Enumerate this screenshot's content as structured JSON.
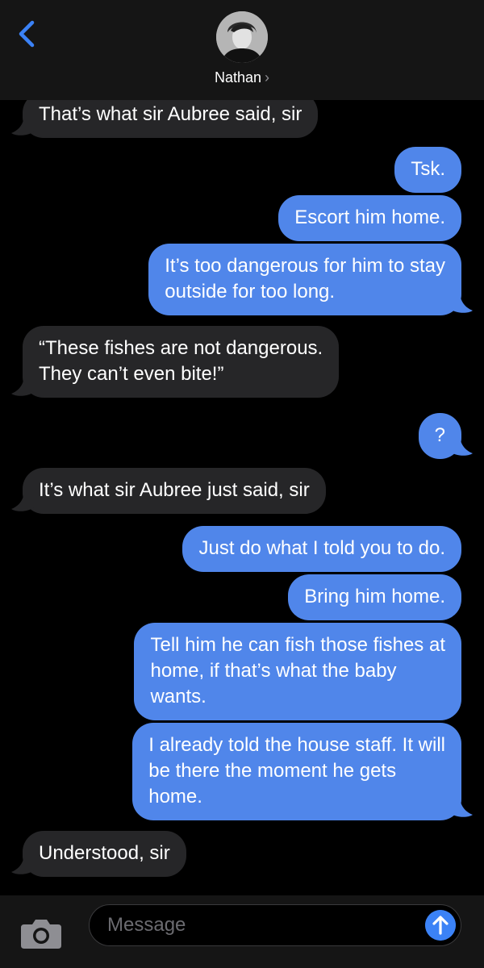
{
  "header": {
    "contact_name": "Nathan",
    "chevron": "›",
    "back_icon": "chevron-left-icon",
    "avatar_icon": "contact-avatar"
  },
  "messages": [
    {
      "side": "in",
      "text": "That’s what sir Aubree said, sir",
      "tail": true
    },
    {
      "side": "out",
      "text": "Tsk.",
      "tail": false
    },
    {
      "side": "out",
      "text": "Escort him home.",
      "tail": false
    },
    {
      "side": "out",
      "text": "It’s too dangerous for him to stay\noutside for too long.",
      "tail": true
    },
    {
      "side": "in",
      "text": "“These fishes are not dangerous.\nThey can’t even bite!”",
      "tail": true
    },
    {
      "side": "out",
      "text": "?",
      "tail": true
    },
    {
      "side": "in",
      "text": "It’s what sir Aubree just said, sir",
      "tail": true
    },
    {
      "side": "out",
      "text": "Just do what I told you to do.",
      "tail": false
    },
    {
      "side": "out",
      "text": "Bring him home.",
      "tail": false
    },
    {
      "side": "out",
      "text": "Tell him he can fish those fishes at\nhome, if that’s what the baby\nwants.",
      "tail": false
    },
    {
      "side": "out",
      "text": "I already told the house staff. It will\nbe there the moment he gets\nhome.",
      "tail": true
    },
    {
      "side": "in",
      "text": "Understood, sir",
      "tail": true
    }
  ],
  "composer": {
    "placeholder": "Message",
    "camera_icon": "camera-icon",
    "send_icon": "send-arrow-up-icon"
  },
  "colors": {
    "incoming_bubble": "#262628",
    "outgoing_bubble": "#5086ea",
    "accent": "#3b82f6",
    "background": "#000000"
  }
}
